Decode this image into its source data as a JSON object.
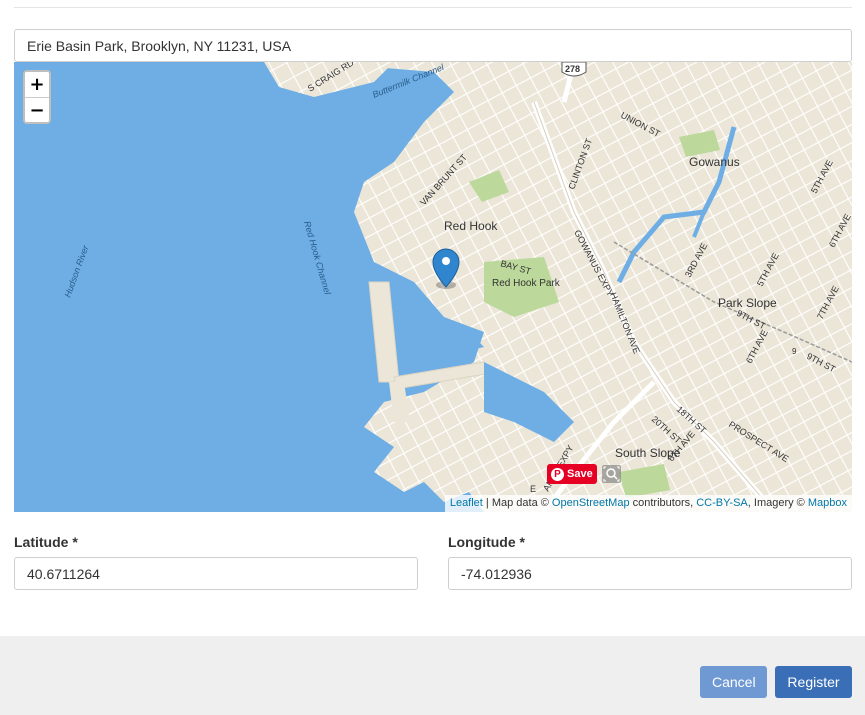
{
  "address": {
    "value": "Erie Basin Park, Brooklyn, NY 11231, USA"
  },
  "map": {
    "zoom_in_label": "+",
    "zoom_out_label": "−",
    "labels": {
      "craig_rd": "S CRAIG RD",
      "buttermilk": "Buttermilk Channel",
      "hwy": "278",
      "union_st": "UNION ST",
      "clinton_st": "CLINTON ST",
      "gowanus": "Gowanus",
      "fifth_ave_top": "5TH AVE",
      "sixth_ave_top": "6TH AVE",
      "van_brunt": "VAN BRUNT ST",
      "red_hook": "Red Hook",
      "bay_st": "BAY ST",
      "red_hook_park": "Red Hook Park",
      "gowanus_expy": "GOWANUS EXPY",
      "hamilton_ave": "HAMILTON AVE",
      "third_ave": "3RD AVE",
      "fifth_ave": "5TH AVE",
      "park_slope": "Park Slope",
      "ninth_st": "9TH ST",
      "ninth_st_2": "9TH ST",
      "sixth_ave": "6TH AVE",
      "seventh_ave": "7TH AVE",
      "hudson_river": "Hudson River",
      "red_hook_channel": "Red Hook Channel",
      "anus_expy": "ANUS EXPY",
      "twentieth_st": "20TH ST",
      "eighteenth_st": "18TH ST",
      "prospect_ave": "PROSPECT AVE",
      "south_slope": "South Slope",
      "sixth_ave_bottom": "6TH AVE",
      "e_fragment": "E",
      "nine_fragment": "9"
    },
    "save_label": "Save",
    "attribution": {
      "leaflet": "Leaflet",
      "map_data": " | Map data © ",
      "osm": "OpenStreetMap",
      "contributors": " contributors, ",
      "license": "CC-BY-SA",
      "imagery": ", Imagery © ",
      "mapbox": "Mapbox"
    },
    "colors": {
      "water": "#6eaee5",
      "land": "#ece6d8",
      "park": "#bcd89a",
      "street": "#ffffff",
      "marker": "#2f86cf"
    }
  },
  "latitude": {
    "label": "Latitude *",
    "value": "40.6711264"
  },
  "longitude": {
    "label": "Longitude *",
    "value": "-74.012936"
  },
  "actions": {
    "cancel_label": "Cancel",
    "register_label": "Register"
  }
}
